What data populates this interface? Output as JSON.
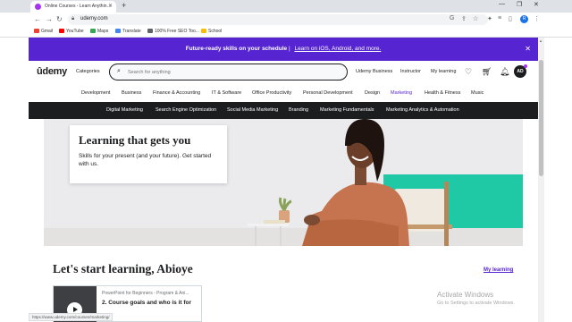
{
  "browser": {
    "tab_title": "Online Courses - Learn Anythin…",
    "new_tab": "+",
    "url": "udemy.com",
    "profile_initial": "R",
    "bookmarks": [
      "Gmail",
      "YouTube",
      "Maps",
      "Translate",
      "100% Free SEO Too...",
      "School"
    ],
    "bookmark_colors": [
      "#ea4335",
      "#ff0000",
      "#34a853",
      "#4285f4",
      "#5f6368",
      "#fbbc04"
    ]
  },
  "promo": {
    "bold": "Future-ready skills on your schedule",
    "separator": "|",
    "link": "Learn on iOS, Android, and more."
  },
  "header": {
    "logo": "ûdemy",
    "categories": "Categories",
    "search_placeholder": "Search for anything",
    "business": "Udemy Business",
    "instructor": "Instructor",
    "my_learning": "My learning",
    "avatar_initials": "AD"
  },
  "categories": [
    "Development",
    "Business",
    "Finance & Accounting",
    "IT & Software",
    "Office Productivity",
    "Personal Development",
    "Design",
    "Marketing",
    "Health & Fitness",
    "Music"
  ],
  "active_category": "Marketing",
  "subcategories": [
    "Digital Marketing",
    "Search Engine Optimization",
    "Social Media Marketing",
    "Branding",
    "Marketing Fundamentals",
    "Marketing Analytics & Automation"
  ],
  "hero": {
    "title": "Learning that gets you",
    "body": "Skills for your present (and your future). Get started with us."
  },
  "welcome": {
    "heading": "Let's start learning, Abioye",
    "my_learning_link": "My learning"
  },
  "course": {
    "title": "PowerPoint for Beginners - Program & Ani...",
    "lesson": "2. Course goals and who is it for"
  },
  "status_url": "https://www.udemy.com/courses/marketing/",
  "watermark": {
    "line1": "Activate Windows",
    "line2": "Go to Settings to activate Windows."
  },
  "colors": {
    "brand_purple": "#a435f0",
    "promo_purple": "#5624d0",
    "dark": "#1c1d1f",
    "teal": "#20c9a6"
  }
}
